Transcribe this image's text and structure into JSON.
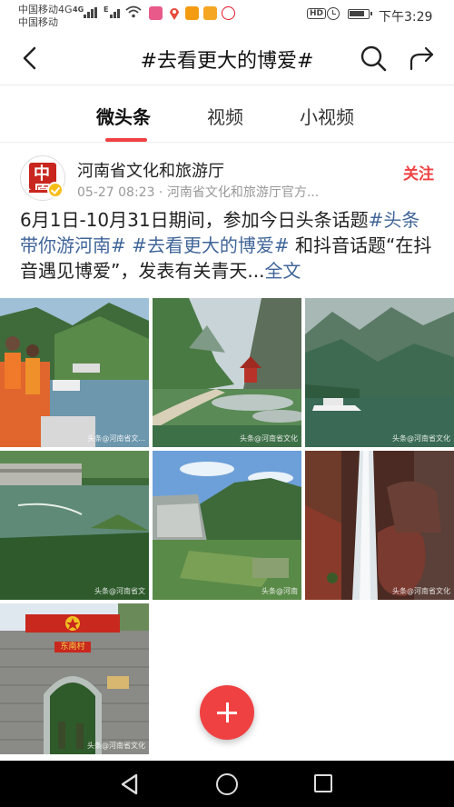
{
  "status_bar": {
    "carrier1": "中国移动4G",
    "carrier2": "中国移动",
    "net1": "4G",
    "net2": "E",
    "hd": "HD",
    "time": "下午3:29"
  },
  "header": {
    "title": "#去看更大的博爱#",
    "back_icon": "back-arrow-icon",
    "search_icon": "search-icon",
    "share_icon": "share-icon"
  },
  "tabs": [
    {
      "label": "微头条",
      "active": true
    },
    {
      "label": "视频",
      "active": false
    },
    {
      "label": "小视频",
      "active": false
    }
  ],
  "post": {
    "author": "河南省文化和旅游厅",
    "meta": "05-27 08:23 · 河南省文化和旅游厅官方...",
    "follow_label": "关注",
    "avatar_text": "中原",
    "text_1": "6月1日-10月31日期间，参加今日头条话题",
    "tag_1": "#头条带你游河南#",
    "text_2": " ",
    "tag_2": "#去看更大的博爱#",
    "text_3": " 和抖音话题“在抖音遇见博爱”，发表有关青天...",
    "expand_label": "全文"
  },
  "images": [
    {
      "name": "boat-tourists-photo",
      "watermark": "头条@河南省文..."
    },
    {
      "name": "gorge-pavilion-photo",
      "watermark": "头条@河南省文化"
    },
    {
      "name": "misty-lake-boat-photo",
      "watermark": "头条@河南省文化"
    },
    {
      "name": "dam-river-photo",
      "watermark": "头条@河南省文"
    },
    {
      "name": "reservoir-dam-photo",
      "watermark": "头条@河南"
    },
    {
      "name": "waterfall-rocks-photo",
      "watermark": "头条@河南省文化"
    },
    {
      "name": "stone-gate-photo",
      "watermark": "头条@河南省文化",
      "gate_sign": "东南村"
    }
  ],
  "fab": {
    "icon": "plus-icon"
  },
  "colors": {
    "accent": "#f04142",
    "link": "#406599"
  }
}
